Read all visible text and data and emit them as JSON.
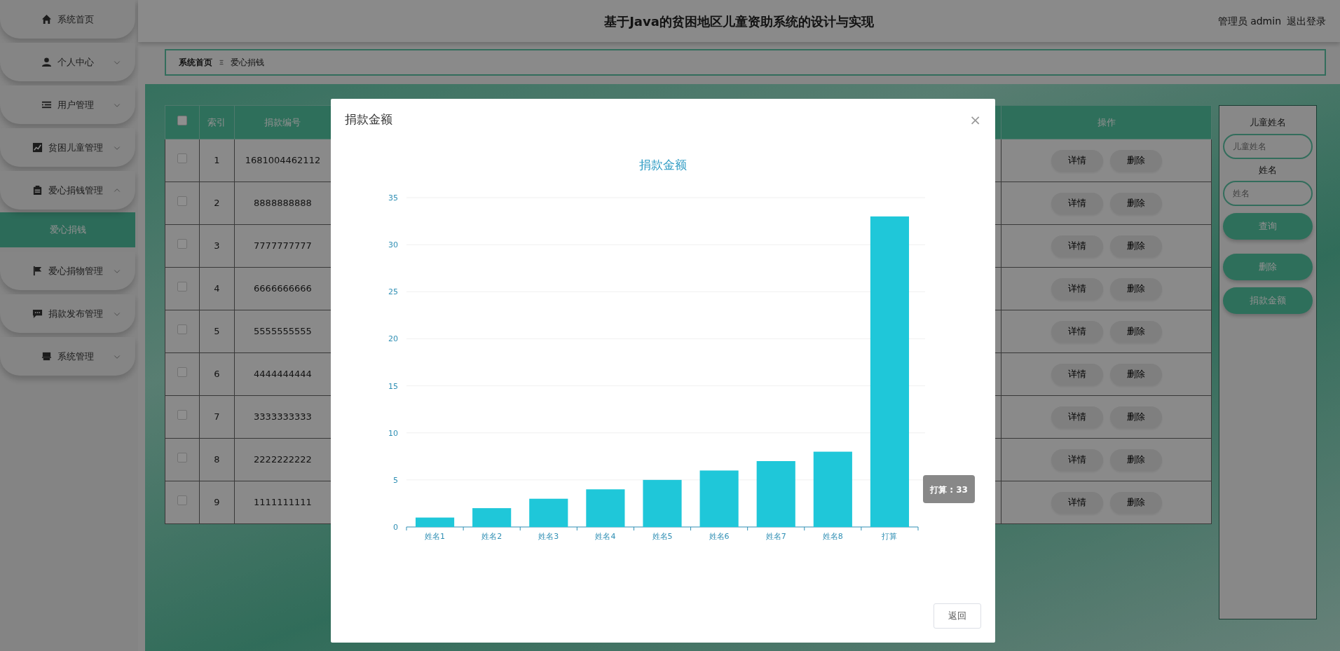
{
  "header": {
    "title": "基于Java的贫困地区儿童资助系统的设计与实现",
    "user": "管理员 admin",
    "logout": "退出登录"
  },
  "sidebar": {
    "items": [
      {
        "label": "系统首页"
      },
      {
        "label": "个人中心",
        "expanded": false
      },
      {
        "label": "用户管理",
        "expanded": false
      },
      {
        "label": "贫困儿童管理",
        "expanded": false
      },
      {
        "label": "爱心捐钱管理",
        "expanded": true,
        "children": [
          {
            "label": "爱心捐钱",
            "selected": true
          }
        ]
      },
      {
        "label": "爱心捐物管理",
        "expanded": false
      },
      {
        "label": "捐款发布管理",
        "expanded": false
      },
      {
        "label": "系统管理",
        "expanded": false
      }
    ]
  },
  "breadcrumb": [
    "系统首页",
    "爱心捐钱"
  ],
  "table": {
    "select_all": false,
    "columns": [
      "索引",
      "捐款编号",
      "操作"
    ],
    "rows": [
      {
        "checked": false,
        "index": "1",
        "number": "1681004462112",
        "actions": [
          "详情",
          "删除"
        ]
      },
      {
        "checked": false,
        "index": "2",
        "number": "8888888888",
        "actions": [
          "详情",
          "删除"
        ]
      },
      {
        "checked": false,
        "index": "3",
        "number": "7777777777",
        "actions": [
          "详情",
          "删除"
        ]
      },
      {
        "checked": false,
        "index": "4",
        "number": "6666666666",
        "actions": [
          "详情",
          "删除"
        ]
      },
      {
        "checked": false,
        "index": "5",
        "number": "5555555555",
        "actions": [
          "详情",
          "删除"
        ]
      },
      {
        "checked": false,
        "index": "6",
        "number": "4444444444",
        "actions": [
          "详情",
          "删除"
        ]
      },
      {
        "checked": false,
        "index": "7",
        "number": "3333333333",
        "actions": [
          "详情",
          "删除"
        ]
      },
      {
        "checked": false,
        "index": "8",
        "number": "2222222222",
        "actions": [
          "详情",
          "删除"
        ]
      },
      {
        "checked": false,
        "index": "9",
        "number": "1111111111",
        "actions": [
          "详情",
          "删除"
        ]
      }
    ]
  },
  "search": {
    "fields": [
      {
        "label": "儿童姓名",
        "placeholder": "儿童姓名"
      },
      {
        "label": "姓名",
        "placeholder": "姓名"
      }
    ],
    "buttons": [
      "查询",
      "删除",
      "捐款金额"
    ]
  },
  "modal": {
    "title": "捐款金额",
    "close": "×",
    "tooltip": "打算 : 33",
    "button": "返回",
    "chart_data": {
      "type": "bar",
      "title": "捐款金额",
      "categories": [
        "姓名1",
        "姓名2",
        "姓名3",
        "姓名4",
        "姓名5",
        "姓名6",
        "姓名7",
        "姓名8",
        "打算"
      ],
      "series": [
        {
          "color": "#1fc7d9",
          "values": [
            1,
            2,
            3,
            4,
            5,
            6,
            7,
            8,
            33
          ]
        }
      ],
      "grid": true,
      "ylim": [
        0,
        35
      ],
      "yticks": [
        0,
        5,
        10,
        15,
        20,
        25,
        30,
        35
      ]
    }
  }
}
